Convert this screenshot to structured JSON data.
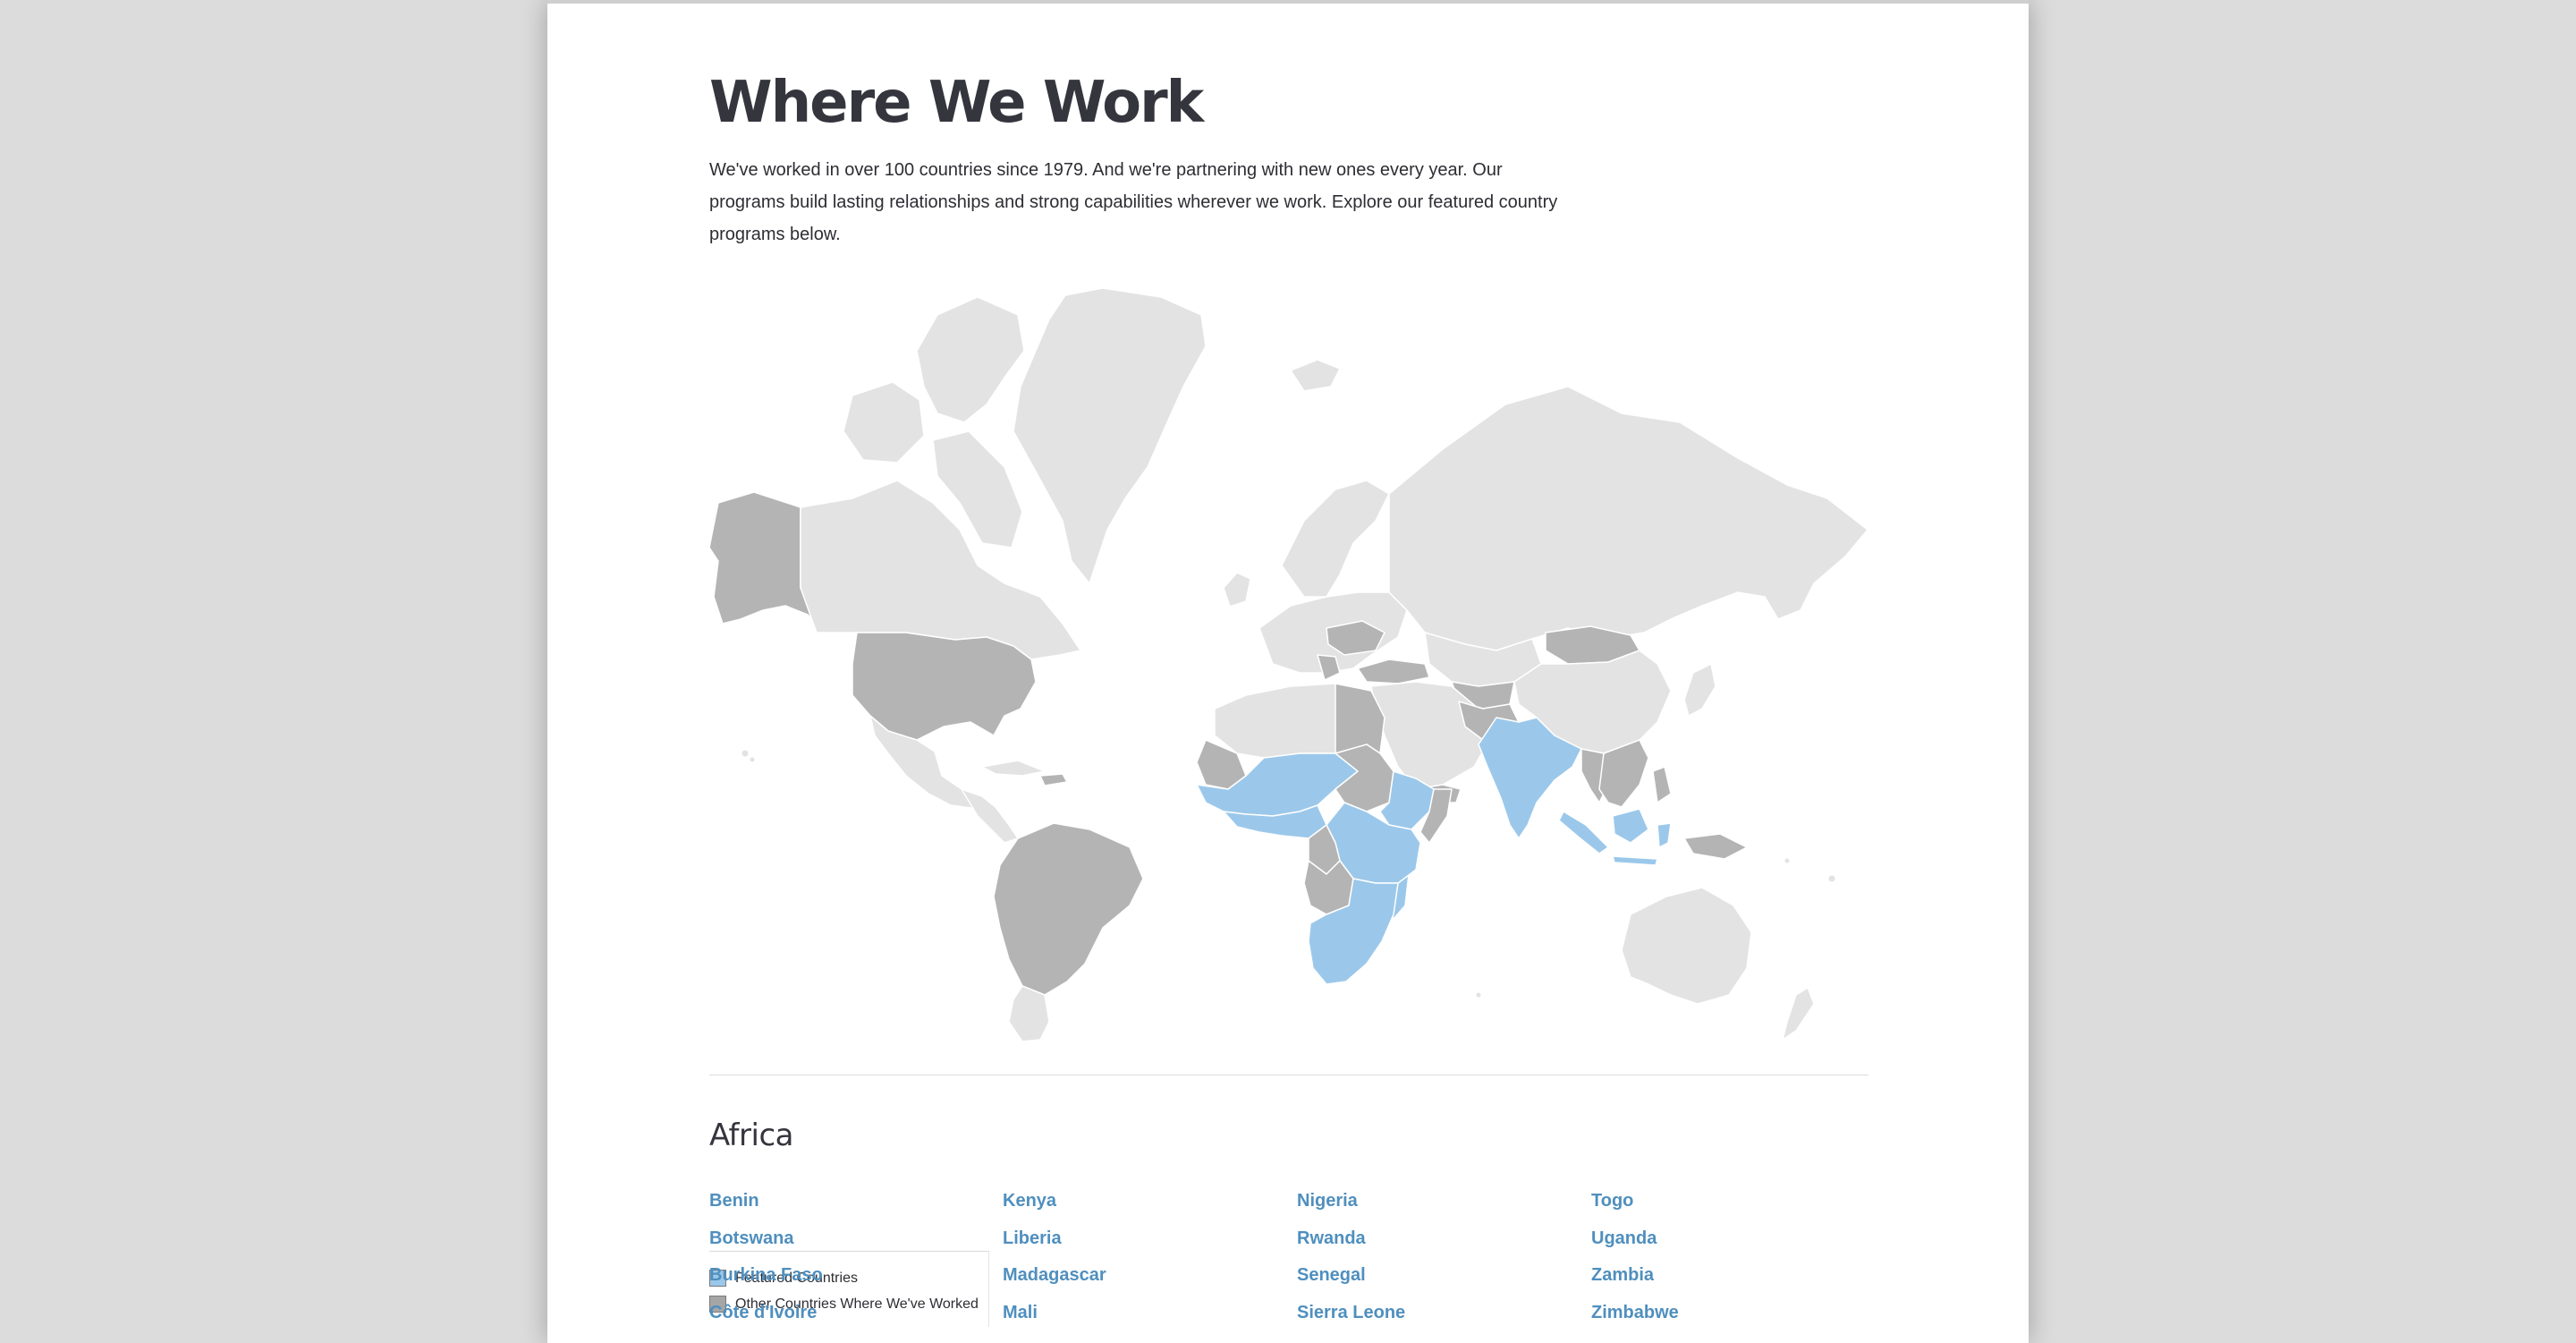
{
  "page": {
    "title": "Where We Work",
    "intro": "We've worked in over 100 countries since 1979. And we're partnering with new ones every year. Our programs build lasting relationships and strong capabilities wherever we work. Explore our featured country programs below."
  },
  "map": {
    "colors": {
      "featured": "#9bc8ea",
      "worked": "#b4b4b4",
      "other": "#e3e3e3",
      "border": "#ffffff"
    },
    "legend": {
      "featured_label": "Featured Countries",
      "worked_label": "Other Countries Where We've Worked"
    }
  },
  "region": {
    "name": "Africa",
    "countries": [
      [
        "Benin",
        "Botswana",
        "Burkina Faso",
        "Côte d'Ivoire"
      ],
      [
        "Kenya",
        "Liberia",
        "Madagascar",
        "Mali"
      ],
      [
        "Nigeria",
        "Rwanda",
        "Senegal",
        "Sierra Leone"
      ],
      [
        "Togo",
        "Uganda",
        "Zambia",
        "Zimbabwe"
      ]
    ]
  }
}
